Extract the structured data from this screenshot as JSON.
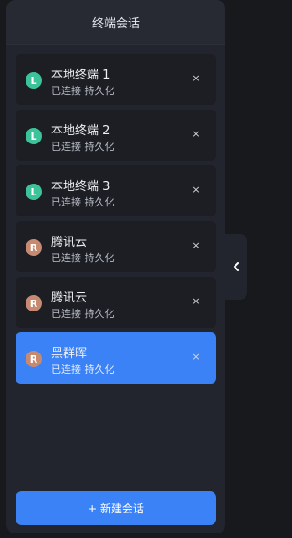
{
  "panel": {
    "title": "终端会话"
  },
  "sessions": [
    {
      "type": "L",
      "name": "本地终端 1",
      "status": "已连接 持久化",
      "close": "×",
      "active": false
    },
    {
      "type": "L",
      "name": "本地终端 2",
      "status": "已连接 持久化",
      "close": "×",
      "active": false
    },
    {
      "type": "L",
      "name": "本地终端 3",
      "status": "已连接 持久化",
      "close": "×",
      "active": false
    },
    {
      "type": "R",
      "name": "腾讯云",
      "status": "已连接 持久化",
      "close": "×",
      "active": false
    },
    {
      "type": "R",
      "name": "腾讯云",
      "status": "已连接 持久化",
      "close": "×",
      "active": false
    },
    {
      "type": "R",
      "name": "黑群晖",
      "status": "已连接 持久化",
      "close": "×",
      "active": true
    }
  ],
  "new_session_button": "+ 新建会话",
  "colors": {
    "accent": "#3b82f6",
    "local_badge": "#3cc39a",
    "remote_badge": "#c78a70"
  },
  "icons": {
    "collapse": "chevron-left-icon"
  }
}
